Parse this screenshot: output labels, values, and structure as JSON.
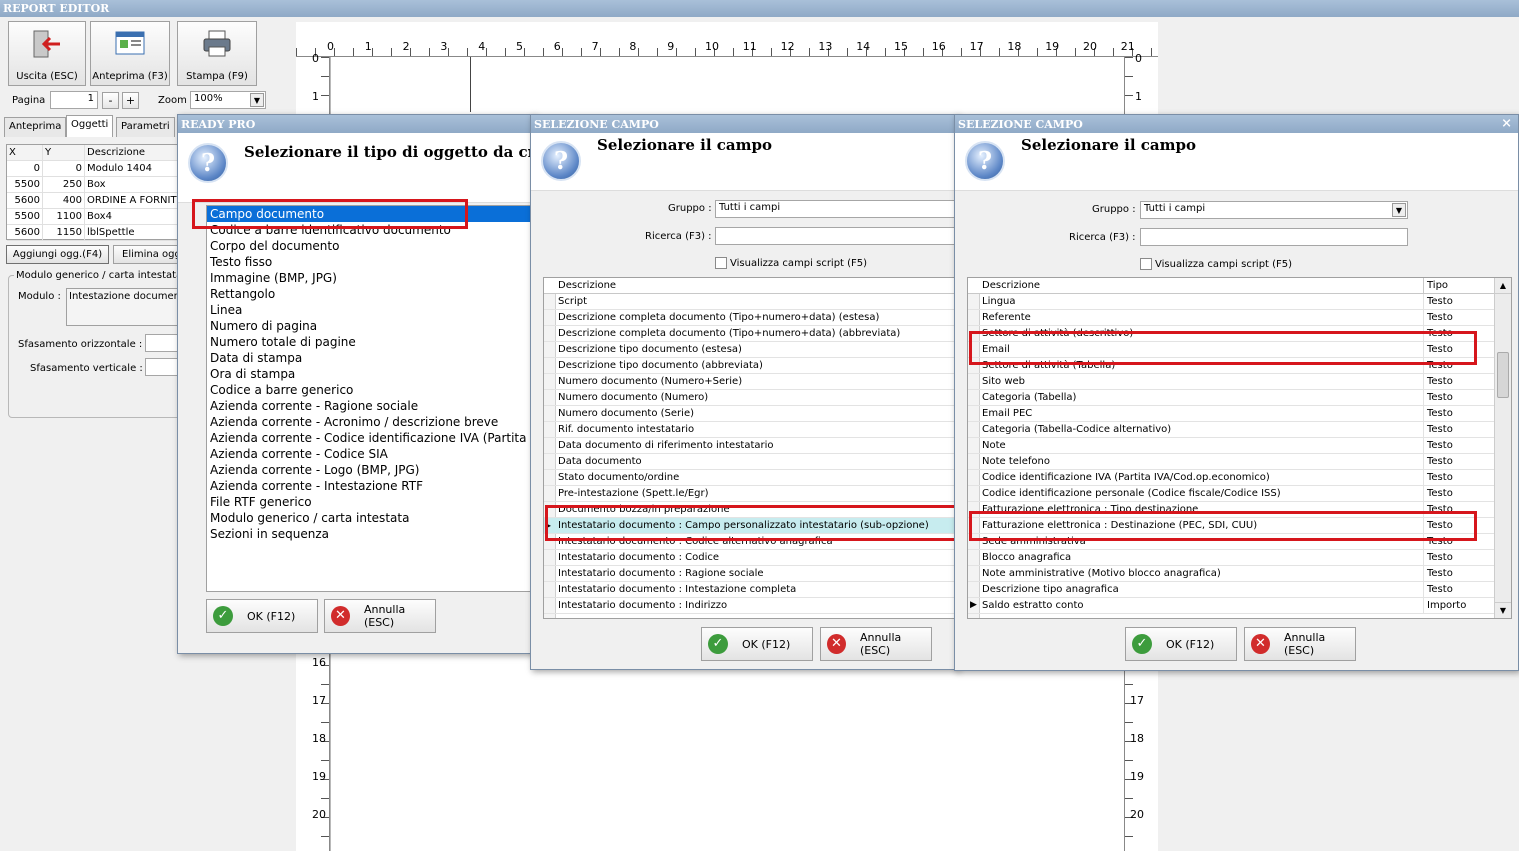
{
  "app": {
    "title": "REPORT EDITOR"
  },
  "toolbar": {
    "exit_label": "Uscita (ESC)",
    "preview_label": "Anteprima (F3)",
    "print_label": "Stampa (F9)",
    "page_label": "Pagina",
    "page_value": "1",
    "minus": "-",
    "plus": "+",
    "zoom_label": "Zoom",
    "zoom_value": "100%"
  },
  "tabs": [
    "Anteprima",
    "Oggetti",
    "Parametri"
  ],
  "objects_grid": {
    "headers": [
      "X",
      "Y",
      "Descrizione"
    ],
    "rows": [
      [
        "0",
        "0",
        "Modulo 1404"
      ],
      [
        "5500",
        "250",
        "Box"
      ],
      [
        "5600",
        "400",
        "ORDINE A FORNIT"
      ],
      [
        "5500",
        "1100",
        "Box4"
      ],
      [
        "5600",
        "1150",
        "lblSpettle"
      ]
    ]
  },
  "objects_actions": {
    "add": "Aggiungi ogg.(F4)",
    "delete": "Elimina ogg"
  },
  "props": {
    "group_title": "Modulo generico / carta intestata",
    "modulo_label": "Modulo :",
    "modulo_value": "Intestazione document",
    "sfas_oriz": "Sfasamento orizzontale :",
    "sfas_vert": "Sfasamento verticale :"
  },
  "ruler": {
    "top_ticks": [
      "0",
      "1",
      "2",
      "3",
      "4",
      "5",
      "6",
      "7",
      "8",
      "9",
      "10",
      "11",
      "12",
      "13",
      "14",
      "15",
      "16",
      "17",
      "18",
      "19",
      "20",
      "21"
    ],
    "left_ticks_top": [
      "0",
      "1"
    ],
    "left_ticks_bottom": [
      "16",
      "17",
      "18",
      "19",
      "20"
    ],
    "right_ticks_top": [
      "0",
      "1"
    ],
    "right_ticks_bottom": [
      "17",
      "18",
      "19",
      "20"
    ]
  },
  "dlg1": {
    "title": "READY PRO",
    "heading": "Selezionare il tipo di oggetto da creare",
    "items": [
      "Campo documento",
      "Codice a barre identificativo documento",
      "Corpo del documento",
      "Testo fisso",
      "Immagine (BMP, JPG)",
      "Rettangolo",
      "Linea",
      "Numero di pagina",
      "Numero totale di pagine",
      "Data di stampa",
      "Ora di stampa",
      "Codice a barre generico",
      "Azienda corrente - Ragione sociale",
      "Azienda corrente - Acronimo / descrizione breve",
      "Azienda corrente - Codice identificazione IVA (Partita Iva",
      "Azienda corrente - Codice SIA",
      "Azienda corrente - Logo (BMP, JPG)",
      "Azienda corrente - Intestazione RTF",
      "File RTF generico",
      "Modulo generico / carta intestata",
      "Sezioni in sequenza"
    ],
    "ok": "OK (F12)",
    "cancel": "Annulla (ESC)"
  },
  "dlg2": {
    "title": "SELEZIONE CAMPO",
    "heading": "Selezionare il campo",
    "gruppo_label": "Gruppo :",
    "gruppo_value": "Tutti i campi",
    "ricerca_label": "Ricerca (F3) :",
    "script_chk": "Visualizza campi script (F5)",
    "col_desc": "Descrizione",
    "rows": [
      "Script",
      "Descrizione completa documento (Tipo+numero+data) (estesa)",
      "Descrizione completa documento (Tipo+numero+data) (abbreviata)",
      "Descrizione tipo documento (estesa)",
      "Descrizione tipo documento (abbreviata)",
      "Numero documento (Numero+Serie)",
      "Numero documento (Numero)",
      "Numero documento (Serie)",
      "Rif. documento intestatario",
      "Data documento di riferimento intestatario",
      "Data documento",
      "Stato documento/ordine",
      "Pre-intestazione (Spett.le/Egr)",
      "Documento bozza/in preparazione",
      "Intestatario documento : Campo personalizzato intestatario (sub-opzione)",
      "Intestatario documento : Codice alternativo anagrafica",
      "Intestatario documento : Codice",
      "Intestatario documento : Ragione sociale",
      "Intestatario documento : Intestazione completa",
      "Intestatario documento : Indirizzo"
    ],
    "ok": "OK (F12)",
    "cancel": "Annulla (ESC)"
  },
  "dlg3": {
    "title": "SELEZIONE CAMPO",
    "close": "×",
    "heading": "Selezionare il campo",
    "gruppo_label": "Gruppo :",
    "gruppo_value": "Tutti i campi",
    "ricerca_label": "Ricerca (F3) :",
    "script_chk": "Visualizza campi script (F5)",
    "col_desc": "Descrizione",
    "col_tipo": "Tipo",
    "rows": [
      [
        "Lingua",
        "Testo"
      ],
      [
        "Referente",
        "Testo"
      ],
      [
        "Settore di attività (descrittivo)",
        "Testo"
      ],
      [
        "Email",
        "Testo"
      ],
      [
        "Settore di attività (Tabella)",
        "Testo"
      ],
      [
        "Sito web",
        "Testo"
      ],
      [
        "Categoria (Tabella)",
        "Testo"
      ],
      [
        "Email PEC",
        "Testo"
      ],
      [
        "Categoria (Tabella-Codice alternativo)",
        "Testo"
      ],
      [
        "Note",
        "Testo"
      ],
      [
        "Note telefono",
        "Testo"
      ],
      [
        "Codice identificazione IVA (Partita IVA/Cod.op.economico)",
        "Testo"
      ],
      [
        "Codice identificazione personale (Codice fiscale/Codice ISS)",
        "Testo"
      ],
      [
        "Fatturazione elettronica : Tipo destinazione",
        "Testo"
      ],
      [
        "Fatturazione elettronica : Destinazione (PEC, SDI, CUU)",
        "Testo"
      ],
      [
        "Sede amministrativa",
        "Testo"
      ],
      [
        "Blocco anagrafica",
        "Testo"
      ],
      [
        "Note amministrative (Motivo blocco anagrafica)",
        "Testo"
      ],
      [
        "Descrizione tipo anagrafica",
        "Testo"
      ],
      [
        "Saldo estratto conto",
        "Importo"
      ]
    ],
    "ok": "OK (F12)",
    "cancel": "Annulla (ESC)"
  },
  "colors": {
    "highlight": "#d6161c",
    "selection": "#0a6fd8",
    "title_bar": "#8fa9c6"
  }
}
